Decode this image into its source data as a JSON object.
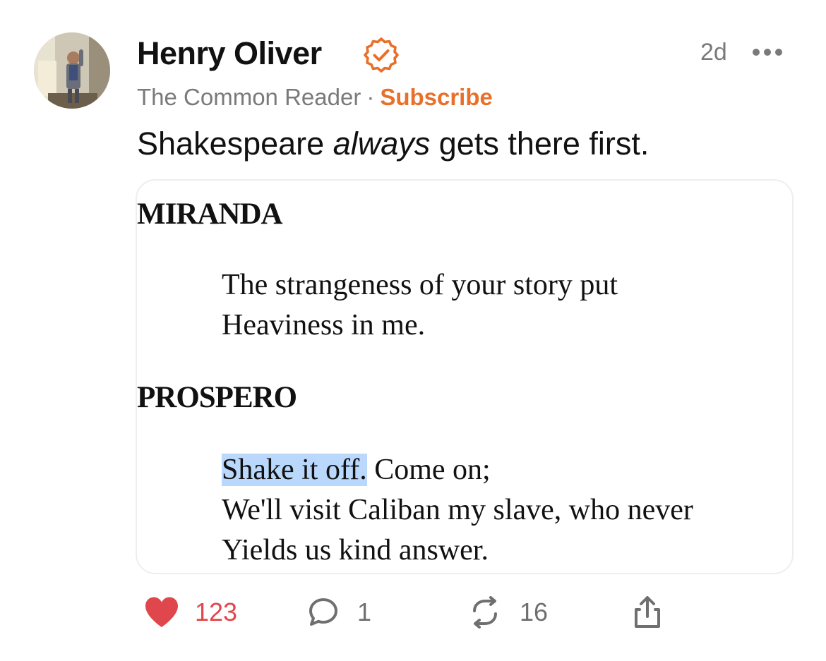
{
  "post": {
    "author": "Henry Oliver",
    "time": "2d",
    "publication": "The Common Reader",
    "separator": "·",
    "subscribe": "Subscribe",
    "text_before": "Shakespeare ",
    "text_emphasis": "always",
    "text_after": " gets there first."
  },
  "card": {
    "speaker1": "MIRANDA",
    "speaker1_lines": [
      "The strangeness of your story put",
      "Heaviness in me."
    ],
    "speaker2": "PROSPERO",
    "highlight": "Shake it off.",
    "line_after_highlight": " Come on;",
    "speaker2_lines": [
      "We'll visit Caliban my slave, who never",
      "Yields us kind answer."
    ]
  },
  "actions": {
    "likes": "123",
    "comments": "1",
    "restacks": "16"
  },
  "colors": {
    "accent": "#e8702a",
    "like": "#e0474c",
    "muted": "#7a7a7a",
    "highlight": "#b9d8fb"
  },
  "icons": {
    "verified": "verified-badge-icon",
    "more": "more-dots-icon",
    "like": "heart-icon",
    "comment": "comment-bubble-icon",
    "restack": "restack-icon",
    "share": "share-icon"
  }
}
